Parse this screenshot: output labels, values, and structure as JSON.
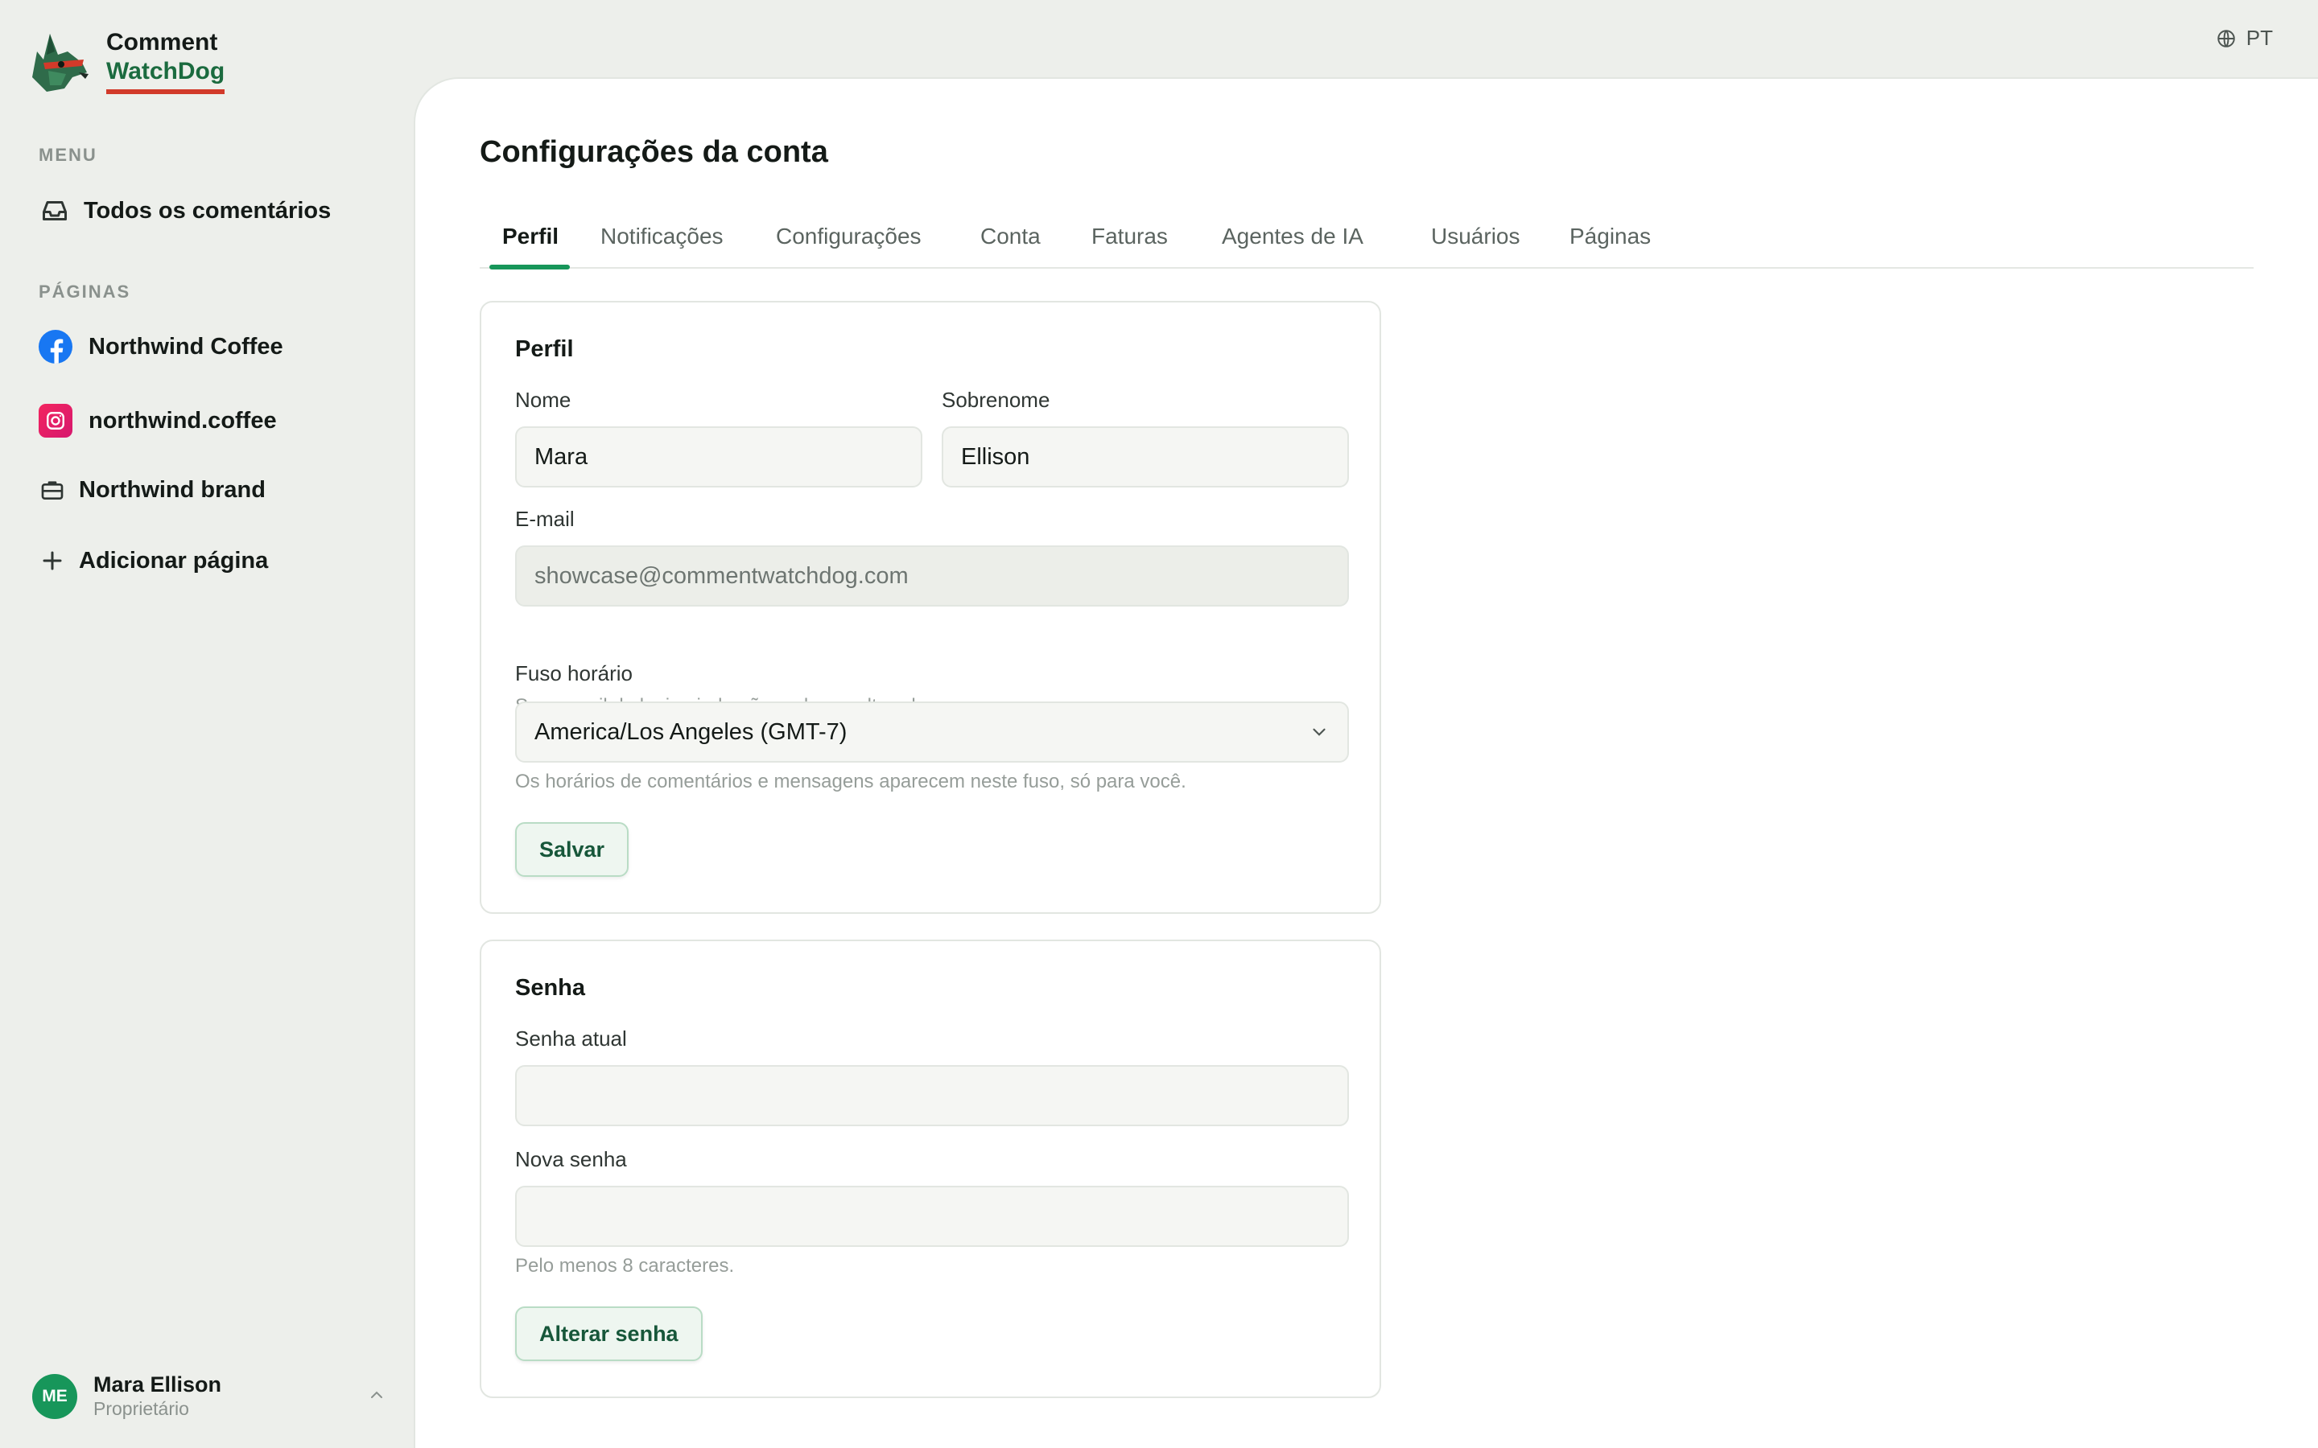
{
  "brand": {
    "line1": "Comment",
    "line2": "WatchDog"
  },
  "sidebar": {
    "menu_label": "MENU",
    "menu_items": [
      {
        "label": "Todos os comentários",
        "icon": "inbox-icon"
      }
    ],
    "pages_label": "PÁGINAS",
    "pages": [
      {
        "label": "Northwind Coffee",
        "icon": "facebook-icon"
      },
      {
        "label": "northwind.coffee",
        "icon": "instagram-icon"
      },
      {
        "label": "Northwind brand",
        "icon": "briefcase-icon"
      },
      {
        "label": "Adicionar página",
        "icon": "plus-icon"
      }
    ],
    "user": {
      "initials": "ME",
      "name": "Mara Ellison",
      "role": "Proprietário"
    }
  },
  "header": {
    "language": "PT"
  },
  "main": {
    "title": "Configurações da conta",
    "tabs": [
      {
        "label": "Perfil",
        "active": true
      },
      {
        "label": "Notificações"
      },
      {
        "label": "Configurações"
      },
      {
        "label": "Conta"
      },
      {
        "label": "Faturas"
      },
      {
        "label": "Agentes de IA"
      },
      {
        "label": "Usuários"
      },
      {
        "label": "Páginas"
      }
    ],
    "profile": {
      "title": "Perfil",
      "first_name_label": "Nome",
      "first_name_value": "Mara",
      "last_name_label": "Sobrenome",
      "last_name_value": "Ellison",
      "email_label": "E-mail",
      "email_value": "showcase@commentwatchdog.com",
      "email_hint": "Seu e-mail de login ainda não pode ser alterado.",
      "timezone_label": "Fuso horário",
      "timezone_value": "America/Los Angeles (GMT-7)",
      "timezone_hint": "Os horários de comentários e mensagens aparecem neste fuso, só para você.",
      "save_label": "Salvar"
    },
    "password": {
      "title": "Senha",
      "current_label": "Senha atual",
      "current_value": "",
      "new_label": "Nova senha",
      "new_value": "",
      "new_hint": "Pelo menos 8 caracteres.",
      "change_label": "Alterar senha"
    }
  },
  "colors": {
    "accent": "#17965a",
    "brand_green": "#1b6b3f",
    "brand_red": "#d23a2a",
    "facebook": "#1877f2",
    "instagram": "#e1306c"
  }
}
